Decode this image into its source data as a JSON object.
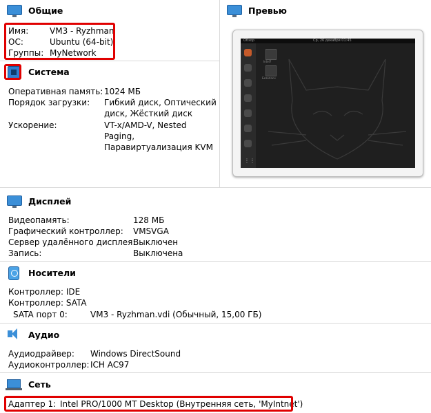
{
  "general": {
    "title": "Общие",
    "rows": [
      {
        "label": "Имя:",
        "value": "VM3 - Ryzhman"
      },
      {
        "label": "ОС:",
        "value": "Ubuntu (64-bit)"
      },
      {
        "label": "Группы:",
        "value": "MyNetwork"
      }
    ]
  },
  "preview": {
    "title": "Превью",
    "topbar_left": "Обзор",
    "topbar_center": "Ср, 26 декабря 01:45",
    "desktop_icons": [
      "Intel7",
      "Безопасн"
    ]
  },
  "system": {
    "title": "Система",
    "rows": [
      {
        "label": "Оперативная память:",
        "lines": [
          "1024 МБ"
        ]
      },
      {
        "label": "Порядок загрузки:",
        "lines": [
          "Гибкий диск, Оптический",
          "диск, Жёсткий диск"
        ]
      },
      {
        "label": "Ускорение:",
        "lines": [
          "VT-x/AMD-V, Nested",
          "Paging,",
          "Паравиртуализация KVM"
        ]
      }
    ]
  },
  "display": {
    "title": "Дисплей",
    "rows": [
      {
        "label": "Видеопамять:",
        "value": "128 МБ"
      },
      {
        "label": "Графический контроллер:",
        "value": "VMSVGA"
      },
      {
        "label": "Сервер удалённого дисплея:",
        "value": "Выключен"
      },
      {
        "label": "Запись:",
        "value": "Выключена"
      }
    ]
  },
  "storage": {
    "title": "Носители",
    "rows": [
      {
        "label": "Контроллер: IDE",
        "value": ""
      },
      {
        "label": "Контроллер: SATA",
        "value": ""
      },
      {
        "label": "SATA порт 0:",
        "value": "VM3 - Ryzhman.vdi (Обычный, 15,00 ГБ)"
      }
    ]
  },
  "audio": {
    "title": "Аудио",
    "rows": [
      {
        "label": "Аудиодрайвер:",
        "value": "Windows DirectSound"
      },
      {
        "label": "Аудиоконтроллер:",
        "value": "ICH AC97"
      }
    ]
  },
  "network": {
    "title": "Сеть",
    "rows": [
      {
        "label": "Адаптер 1:",
        "value": "Intel PRO/1000 MT Desktop (Внутренняя сеть, 'MyIntnet')"
      }
    ]
  },
  "colors": {
    "highlight": "#e00000",
    "header_bg": "#e6edf5",
    "icon_blue": "#3b8fd8"
  },
  "icons": {
    "general": "monitor-icon",
    "system": "chip-icon",
    "display": "monitor-icon",
    "storage": "disk-icon",
    "audio": "speaker-icon",
    "network": "network-icon"
  }
}
